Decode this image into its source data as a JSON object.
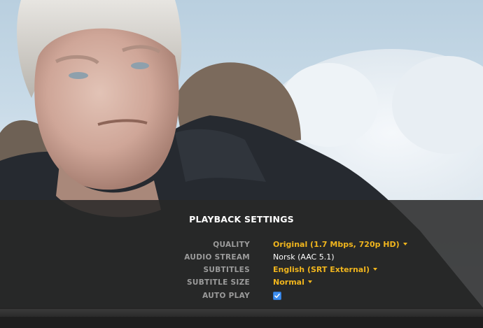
{
  "settings_panel": {
    "title": "PLAYBACK SETTINGS",
    "rows": [
      {
        "label": "QUALITY",
        "value": "Original (1.7 Mbps, 720p HD)",
        "type": "dropdown"
      },
      {
        "label": "AUDIO STREAM",
        "value": "Norsk (AAC 5.1)",
        "type": "static"
      },
      {
        "label": "SUBTITLES",
        "value": "English (SRT External)",
        "type": "dropdown"
      },
      {
        "label": "SUBTITLE SIZE",
        "value": "Normal",
        "type": "dropdown"
      },
      {
        "label": "AUTO PLAY",
        "checked": true,
        "type": "checkbox"
      }
    ]
  },
  "colors": {
    "accent": "#f0b51d",
    "label": "#9b9b9b",
    "checkbox": "#3d8ef0"
  }
}
